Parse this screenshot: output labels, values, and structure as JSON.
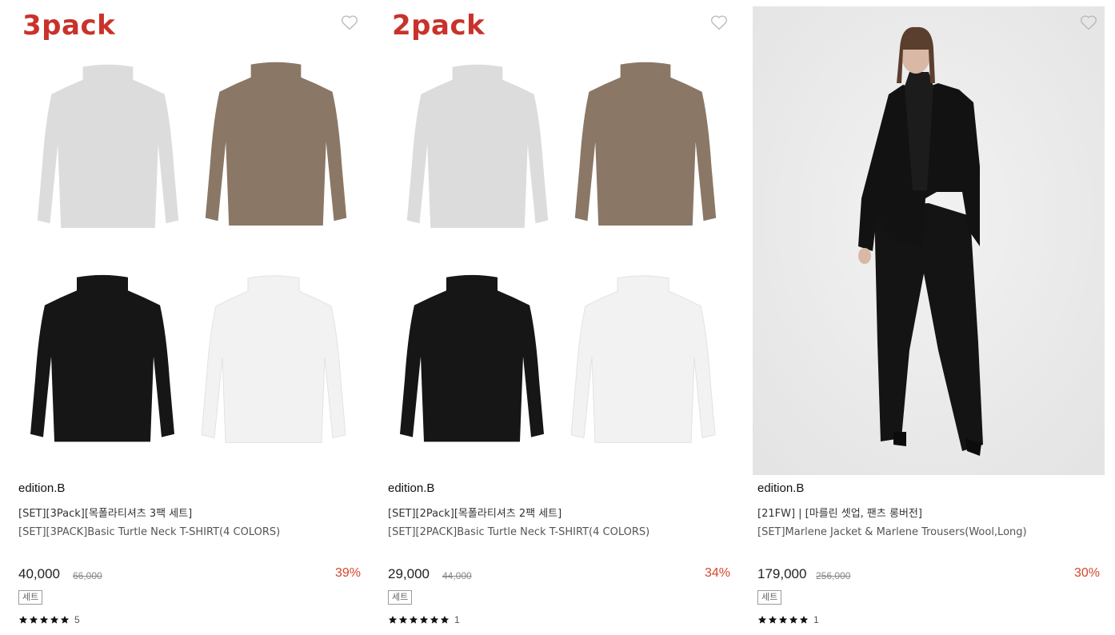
{
  "products": [
    {
      "pack_label": "3pack",
      "brand": "edition.B",
      "name_ko": "[SET][3Pack][목폴라티셔츠 3팩 세트]",
      "name_en": "[SET][3PACK]Basic Turtle Neck T-SHIRT(4 COLORS)",
      "price": "40,000",
      "original_price": "66,000",
      "discount": "39%",
      "badge": "세트",
      "rating_stars": 5,
      "review_count": "5",
      "image": "turtleneck-4-colors-grid",
      "shirt_colors": [
        "#dcdcdc",
        "#8b7766",
        "#161616",
        "#f4f4f4"
      ]
    },
    {
      "pack_label": "2pack",
      "brand": "edition.B",
      "name_ko": "[SET][2Pack][목폴라티셔츠 2팩 세트]",
      "name_en": "[SET][2PACK]Basic Turtle Neck T-SHIRT(4 COLORS)",
      "price": "29,000",
      "original_price": "44,000",
      "discount": "34%",
      "badge": "세트",
      "rating_stars": 5,
      "review_count": "1",
      "image": "turtleneck-4-colors-grid",
      "shirt_colors": [
        "#dcdcdc",
        "#8b7766",
        "#161616",
        "#f4f4f4"
      ]
    },
    {
      "pack_label": "",
      "brand": "edition.B",
      "name_ko": "[21FW] | [마를린 셋업, 팬츠 롱버전]",
      "name_en": "[SET]Marlene Jacket & Marlene Trousers(Wool,Long)",
      "price": "179,000",
      "original_price": "256,000",
      "discount": "30%",
      "badge": "세트",
      "rating_stars": 5,
      "review_count": "1",
      "image": "model-black-suit-photo"
    }
  ],
  "icons": {
    "wishlist": "heart-outline-icon",
    "star": "star-filled-icon"
  },
  "colors": {
    "pack_label": "#c9322b",
    "discount": "#d4462e",
    "photo_bg": "#ebebeb",
    "suit": "#141414"
  }
}
